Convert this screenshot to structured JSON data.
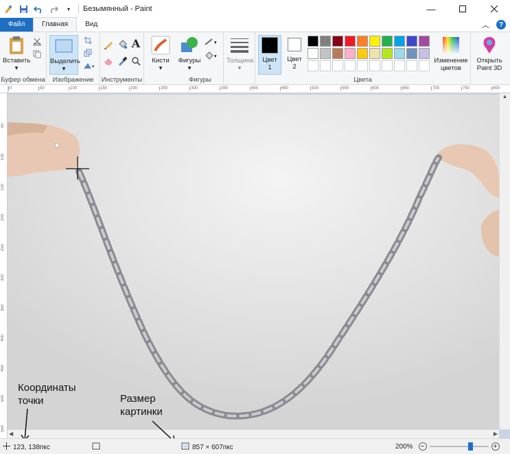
{
  "window": {
    "title": "Безымянный - Paint"
  },
  "tabs": {
    "file": "Файл",
    "home": "Главная",
    "view": "Вид"
  },
  "ribbon": {
    "paste": "Вставить",
    "clipboard_group": "Буфер обмена",
    "select": "Выделить",
    "image_group": "Изображение",
    "tools_group": "Инструменты",
    "brushes": "Кисти",
    "shapes": "Фигуры",
    "shapes_group": "Фигуры",
    "thickness": "Толщина",
    "color1": "Цвет",
    "color1_num": "1",
    "color2": "Цвет",
    "color2_num": "2",
    "colors_group": "Цвета",
    "edit_colors_1": "Изменение",
    "edit_colors_2": "цветов",
    "paint3d_1": "Открыть",
    "paint3d_2": "Paint 3D"
  },
  "palette": {
    "row1": [
      "#000000",
      "#7f7f7f",
      "#880015",
      "#ed1c24",
      "#ff7f27",
      "#fff200",
      "#22b14c",
      "#00a2e8",
      "#3f48cc",
      "#a349a4"
    ],
    "row2": [
      "#ffffff",
      "#c3c3c3",
      "#b97a57",
      "#ffaec9",
      "#ffc90e",
      "#efe4b0",
      "#b5e61d",
      "#99d9ea",
      "#7092be",
      "#c8bfe7"
    ]
  },
  "ruler_h": [
    "0",
    "50",
    "100",
    "150",
    "200",
    "250",
    "300",
    "350",
    "400",
    "450",
    "500",
    "550",
    "600",
    "650",
    "700",
    "750",
    "800"
  ],
  "ruler_v": [
    "50",
    "100",
    "150",
    "200",
    "250",
    "300",
    "350",
    "400",
    "450",
    "500",
    "550"
  ],
  "status": {
    "coords": "123, 138пкс",
    "size": "857 × 607пкс",
    "zoom": "200%"
  },
  "annotations": {
    "coords_1": "Координаты",
    "coords_2": "точки",
    "size_1": "Размер",
    "size_2": "картинки"
  }
}
